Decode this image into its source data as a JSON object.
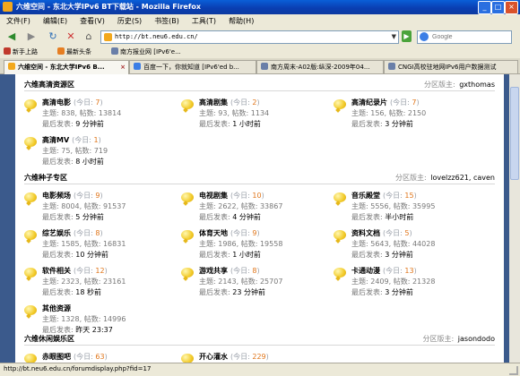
{
  "window": {
    "title": "六维空间 - 东北大学IPv6 BT下载站 - Mozilla Firefox",
    "minimize_glyph": "_",
    "maximize_glyph": "□",
    "close_glyph": "×"
  },
  "menu": [
    "文件(F)",
    "编辑(E)",
    "查看(V)",
    "历史(S)",
    "书签(B)",
    "工具(T)",
    "帮助(H)"
  ],
  "nav": {
    "back_glyph": "◀",
    "forward_glyph": "▶",
    "reload_glyph": "↻",
    "stop_glyph": "✕",
    "home_glyph": "⌂",
    "url": "http://bt.neu6.edu.cn/",
    "go_glyph": "▶",
    "search_placeholder": "Google"
  },
  "bookmarks": [
    {
      "label": "新手上路",
      "icon": "bookmark-red-icon",
      "color": "#c0392b"
    },
    {
      "label": "最新头条",
      "icon": "rss-icon",
      "color": "#e67e22"
    },
    {
      "label": "南方报业网 [IPv6'e...",
      "icon": "page-icon",
      "color": "#6a7fa8"
    }
  ],
  "tabs": [
    {
      "label": "六维空间 - 东北大学IPv6 B...",
      "active": true
    },
    {
      "label": "百度一下，你就知道 [IPv6'ed b...",
      "active": false
    },
    {
      "label": "南方周末-A02版:纵深-2009年04...",
      "active": false
    },
    {
      "label": "CNGI高校驻地网IPv6用户数据测试",
      "active": false
    }
  ],
  "today_label": "今日",
  "stats_labels": {
    "topics": "主题",
    "posts": "帖数",
    "last": "最后发表"
  },
  "moderator_label": "分区版主",
  "sections": [
    {
      "title": "六维高清资源区",
      "moderator": "gxthomas",
      "forums": [
        {
          "name": "高清电影",
          "today": 7,
          "topics": 838,
          "posts": 13814,
          "last": "9 分钟前"
        },
        {
          "name": "高清剧集",
          "today": 2,
          "topics": 93,
          "posts": 1134,
          "last": "1 小时前"
        },
        {
          "name": "高清纪录片",
          "today": 7,
          "topics": 156,
          "posts": 2150,
          "last": "3 分钟前"
        },
        {
          "name": "高清MV",
          "today": 1,
          "topics": 75,
          "posts": 719,
          "last": "8 小时前"
        }
      ]
    },
    {
      "title": "六维种子专区",
      "moderator": "lovelzz621, caven",
      "forums": [
        {
          "name": "电影频场",
          "today": 9,
          "topics": 8004,
          "posts": 91537,
          "last": "5 分钟前"
        },
        {
          "name": "电视剧集",
          "today": 10,
          "topics": 2622,
          "posts": 33867,
          "last": "4 分钟前"
        },
        {
          "name": "音乐殿堂",
          "today": 15,
          "topics": 5556,
          "posts": 35995,
          "last": "半小时前"
        },
        {
          "name": "综艺娱乐",
          "today": 8,
          "topics": 1585,
          "posts": 16831,
          "last": "10 分钟前"
        },
        {
          "name": "体育天地",
          "today": 9,
          "topics": 1986,
          "posts": 19558,
          "last": "1 小时前"
        },
        {
          "name": "资料文档",
          "today": 5,
          "topics": 5643,
          "posts": 44028,
          "last": "3 分钟前"
        },
        {
          "name": "软件相关",
          "today": 12,
          "topics": 2323,
          "posts": 23161,
          "last": "18 秒前"
        },
        {
          "name": "游戏共享",
          "today": 8,
          "topics": 2143,
          "posts": 25707,
          "last": "23 分钟前"
        },
        {
          "name": "卡通动漫",
          "today": 13,
          "topics": 2409,
          "posts": 21328,
          "last": "3 分钟前"
        },
        {
          "name": "其他资源",
          "today": null,
          "topics": 1328,
          "posts": 14996,
          "last": "昨天 23:37"
        }
      ]
    },
    {
      "title": "六维休闲娱乐区",
      "moderator": "jasondodo",
      "forums": [
        {
          "name": "赤眼图吧",
          "today": 63
        },
        {
          "name": "开心灌水",
          "today": 229
        }
      ]
    }
  ],
  "status": "http://bt.neu6.edu.cn/forumdisplay.php?fid=17"
}
